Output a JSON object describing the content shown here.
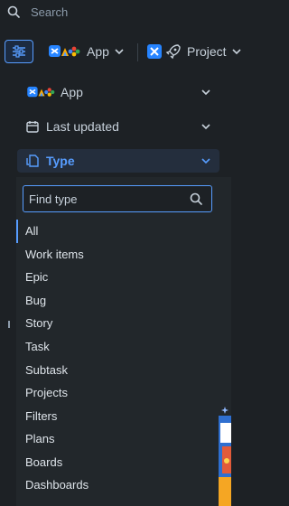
{
  "search": {
    "placeholder": "Search"
  },
  "toolbar": {
    "app_label": "App",
    "project_label": "Project"
  },
  "filters": {
    "app_label": "App",
    "last_updated_label": "Last updated",
    "type_label": "Type"
  },
  "type_dropdown": {
    "find_placeholder": "Find type",
    "items": [
      "All",
      "Work items",
      "Epic",
      "Bug",
      "Story",
      "Task",
      "Subtask",
      "Projects",
      "Filters",
      "Plans",
      "Boards",
      "Dashboards"
    ]
  },
  "colors": {
    "accent": "#579dff",
    "background": "#1d2125",
    "text": "#c7d1db"
  }
}
